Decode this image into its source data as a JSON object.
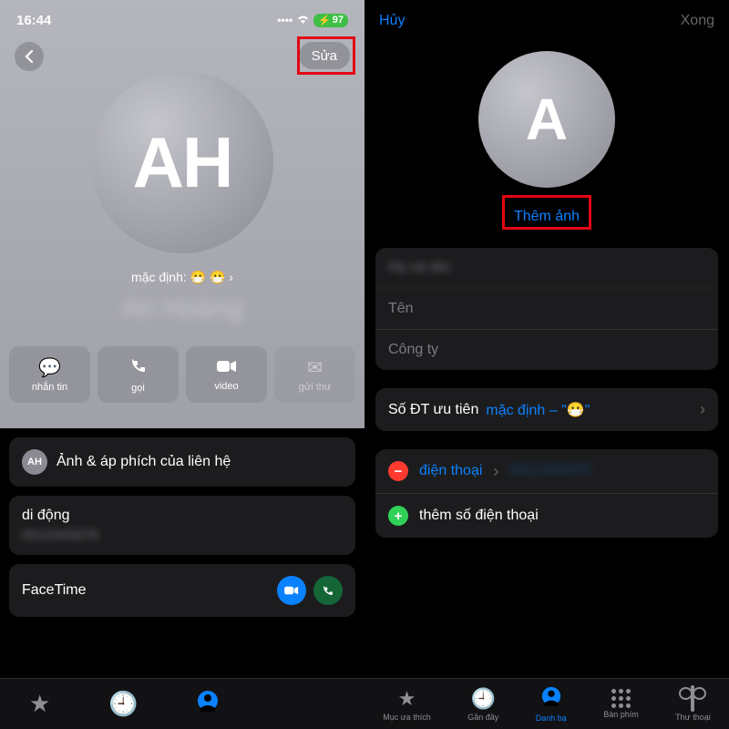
{
  "left": {
    "time": "16:44",
    "battery": "97",
    "edit_btn": "Sửa",
    "avatar_initials": "AH",
    "default_label": "mặc định: 😷 😷 ›",
    "contact_name_blurred": "An Hoàng",
    "actions": {
      "message": "nhắn tin",
      "call": "gọi",
      "video": "video",
      "mail": "gửi thư"
    },
    "poster_cell_initials": "AH",
    "poster_cell_label": "Ảnh & áp phích của liên hệ",
    "mobile_label": "di động",
    "facetime_label": "FaceTime"
  },
  "right": {
    "cancel": "Hủy",
    "done": "Xong",
    "avatar_initials": "A",
    "add_photo": "Thêm ảnh",
    "fields": {
      "name": "Tên",
      "company": "Công ty"
    },
    "priority": {
      "label": "Số ĐT ưu tiên",
      "value": "mặc định – \"😷\""
    },
    "phone_type": "điện thoại",
    "add_phone": "thêm số điện thoại"
  },
  "tabs": {
    "favorites": "Mục ưa thích",
    "recents": "Gần đây",
    "contacts": "Danh bạ",
    "keypad": "Bàn phím",
    "voicemail": "Thư thoại"
  }
}
